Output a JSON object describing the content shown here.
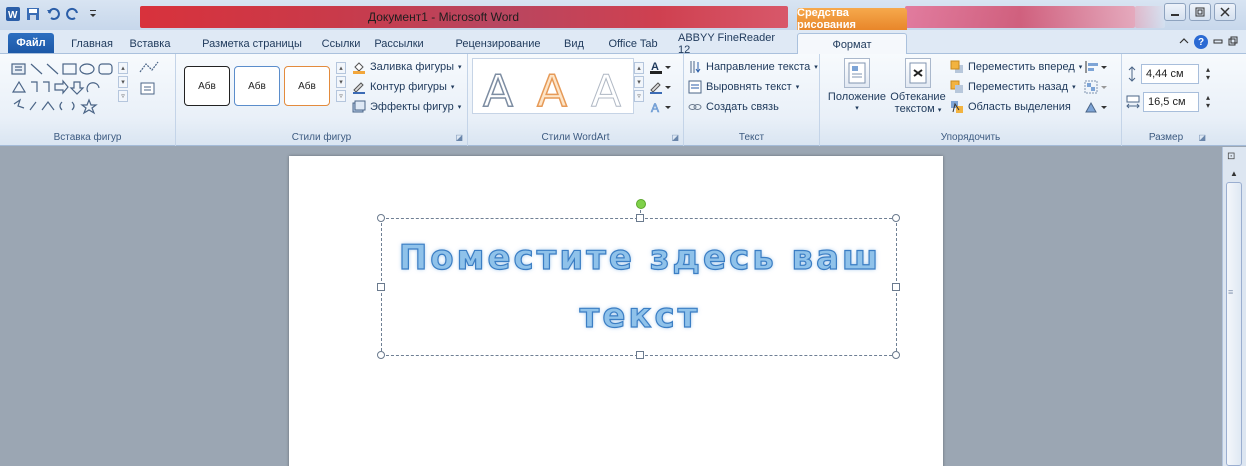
{
  "titlebar": {
    "title": "Документ1 - Microsoft Word",
    "context_tab": "Средства рисования"
  },
  "tabs": {
    "file": "Файл",
    "items": [
      "Главная",
      "Вставка",
      "Разметка страницы",
      "Ссылки",
      "Рассылки",
      "Рецензирование",
      "Вид",
      "Office Tab",
      "ABBYY FineReader 12",
      "Формат"
    ],
    "active": "Формат"
  },
  "ribbon": {
    "insert_shapes": {
      "label": "Вставка фигур"
    },
    "shape_styles": {
      "label": "Стили фигур",
      "thumbs": [
        "Абв",
        "Абв",
        "Абв"
      ],
      "fill": "Заливка фигуры",
      "outline": "Контур фигуры",
      "effects": "Эффекты фигур"
    },
    "wordart": {
      "label": "Стили WordArt",
      "sample": "A"
    },
    "text": {
      "label": "Текст",
      "direction": "Направление текста",
      "align": "Выровнять текст",
      "link": "Создать связь"
    },
    "arrange": {
      "label": "Упорядочить",
      "position": "Положение",
      "wrap_line1": "Обтекание",
      "wrap_line2": "текстом",
      "forward": "Переместить вперед",
      "backward": "Переместить назад",
      "selection": "Область выделения"
    },
    "size": {
      "label": "Размер",
      "height": "4,44 см",
      "width": "16,5 см"
    }
  },
  "document": {
    "wordart_line1": "Поместите здесь ваш",
    "wordart_line2": "текст"
  },
  "colors": {
    "context_tab": "#e8862a",
    "file_tab": "#1c58a7",
    "wordart_fill": "#8fc2ea",
    "wordart_stroke": "#3b7ec4"
  }
}
